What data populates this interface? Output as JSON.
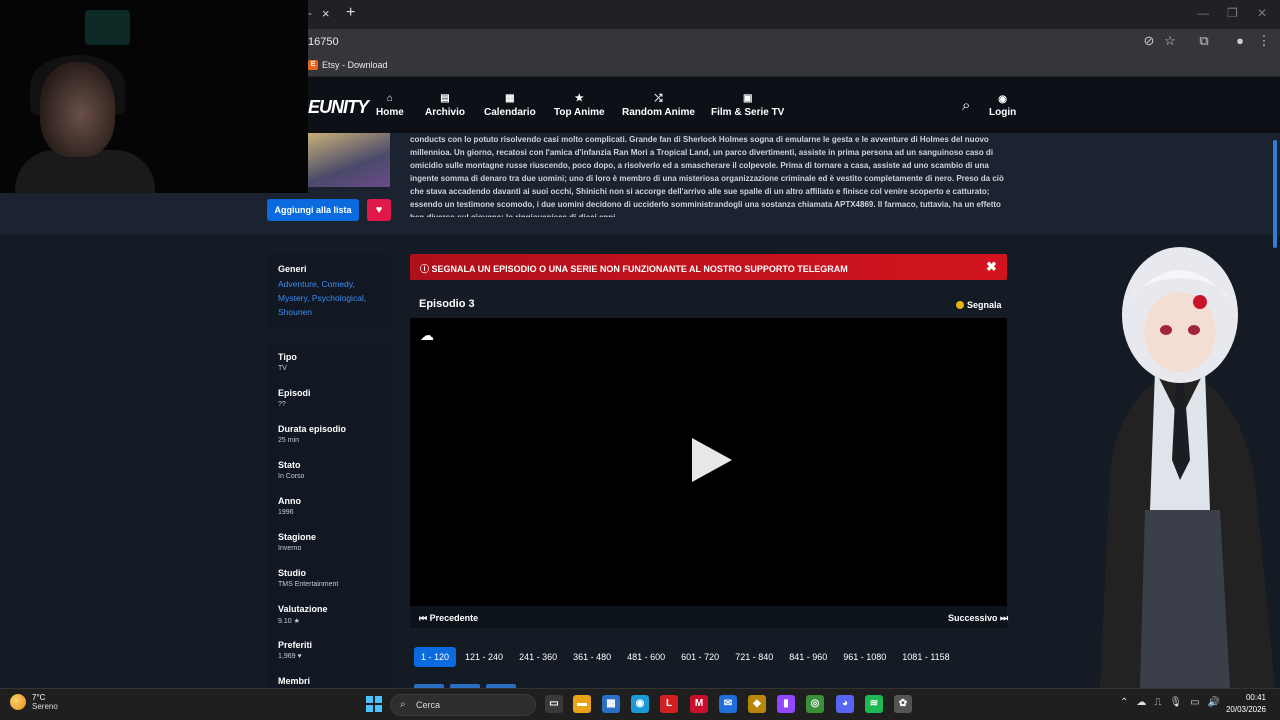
{
  "browser": {
    "tab_close": "×",
    "tab_new": "+",
    "tab_fragment": "-",
    "url": "16750",
    "bookmark_label": "Etsy - Download",
    "bookmark_icon_letter": "E",
    "window_controls": [
      "—",
      "❐",
      "✕"
    ]
  },
  "site": {
    "logo": "EUNITY",
    "nav": [
      {
        "label": "Home",
        "icon": "home-icon",
        "glyph": "⌂"
      },
      {
        "label": "Archivio",
        "icon": "archive-icon",
        "glyph": "▤"
      },
      {
        "label": "Calendario",
        "icon": "calendar-icon",
        "glyph": "▦"
      },
      {
        "label": "Top Anime",
        "icon": "star-icon",
        "glyph": "★"
      },
      {
        "label": "Random Anime",
        "icon": "shuffle-icon",
        "glyph": "⤮"
      },
      {
        "label": "Film & Serie TV",
        "icon": "film-icon",
        "glyph": "▣"
      }
    ],
    "login_label": "Login"
  },
  "description": "conducts con lo potuto risolvendo casi molto complicati. Grande fan di Sherlock Holmes sogna di emularne le gesta e le avventure di Holmes del nuovo millennioa. Un giorno, recatosi con l'amica d'infanzia Ran Mori a Tropical Land, un parco divertimenti, assiste in prima persona ad un sanguinoso caso di omicidio sulle montagne russe riuscendo, poco dopo, a risolverlo ed a smascherare il colpevole. Prima di tornare a casa, assiste ad uno scambio di una ingente somma di denaro tra due uomini; uno di loro è membro di una misteriosa organizzazione criminale ed è vestito completamente di nero. Preso da ciò che stava accadendo davanti ai suoi occhi, Shinichi non si accorge dell'arrivo alle sue spalle di un altro affiliato e finisce col venire scoperto e catturato; essendo un testimone scomodo, i due uomini decidono di ucciderlo somministrandogli una sostanza chiamata APTX4869. Il farmaco, tuttavia, ha un effetto ben diverso sul giovane: lo ringiovanisce di dieci anni.",
  "actions": {
    "add_to_list": "Aggiungi alla lista",
    "fav_glyph": "♥"
  },
  "sidebar": {
    "genres_label": "Generi",
    "genres": "Adventure, Comedy, Mystery, Psychological, Shounen",
    "info": [
      {
        "label": "Tipo",
        "value": "TV"
      },
      {
        "label": "Episodi",
        "value": "??"
      },
      {
        "label": "Durata episodio",
        "value": "25 min"
      },
      {
        "label": "Stato",
        "value": "In Corso"
      },
      {
        "label": "Anno",
        "value": "1996"
      },
      {
        "label": "Stagione",
        "value": "Inverno"
      },
      {
        "label": "Studio",
        "value": "TMS Entertainment"
      },
      {
        "label": "Valutazione",
        "value": "9.10 ★"
      },
      {
        "label": "Preferiti",
        "value": "1,969 ♥"
      },
      {
        "label": "Membri",
        "value": ""
      }
    ]
  },
  "player": {
    "report_text": "ⓘ SEGNALA UN EPISODIO O UNA SERIE NON FUNZIONANTE AL NOSTRO SUPPORTO TELEGRAM",
    "report_close": "✖",
    "episode_title": "Episodio 3",
    "report_button": "Segnala",
    "prev_label": "⏮ Precedente",
    "next_label": "Successivo ⏭"
  },
  "ranges": [
    "1 - 120",
    "121 - 240",
    "241 - 360",
    "361 - 480",
    "481 - 600",
    "601 - 720",
    "721 - 840",
    "841 - 960",
    "961 - 1080",
    "1081 - 1158"
  ],
  "active_range": 0,
  "taskbar": {
    "temperature": "7°C",
    "condition": "Sereno",
    "search_label": "Cerca",
    "time": "00:41",
    "date": "20/03/2026",
    "apps": [
      {
        "name": "task-view-icon",
        "glyph": "▭",
        "color": "#3a3a3a"
      },
      {
        "name": "file-explorer-icon",
        "glyph": "▬",
        "color": "#e8a317"
      },
      {
        "name": "store-icon",
        "glyph": "▦",
        "color": "#2b6fc7"
      },
      {
        "name": "edge-icon",
        "glyph": "◉",
        "color": "#1a9bd7"
      },
      {
        "name": "l-app-icon",
        "glyph": "L",
        "color": "#d02020"
      },
      {
        "name": "mcafee-icon",
        "glyph": "M",
        "color": "#c8102e"
      },
      {
        "name": "mail-icon",
        "glyph": "✉",
        "color": "#1e6fd9"
      },
      {
        "name": "game-icon",
        "glyph": "◆",
        "color": "#b8860b"
      },
      {
        "name": "twitch-icon",
        "glyph": "▮",
        "color": "#9146ff"
      },
      {
        "name": "chrome-icon",
        "glyph": "◎",
        "color": "#3a8f3a"
      },
      {
        "name": "discord-icon",
        "glyph": "◕",
        "color": "#5865f2"
      },
      {
        "name": "spotify-icon",
        "glyph": "≋",
        "color": "#1db954"
      },
      {
        "name": "settings-app-icon",
        "glyph": "✿",
        "color": "#555"
      }
    ],
    "tray": [
      "⌃",
      "☁",
      "⎍",
      "🎙",
      "▭",
      "🔊"
    ]
  }
}
